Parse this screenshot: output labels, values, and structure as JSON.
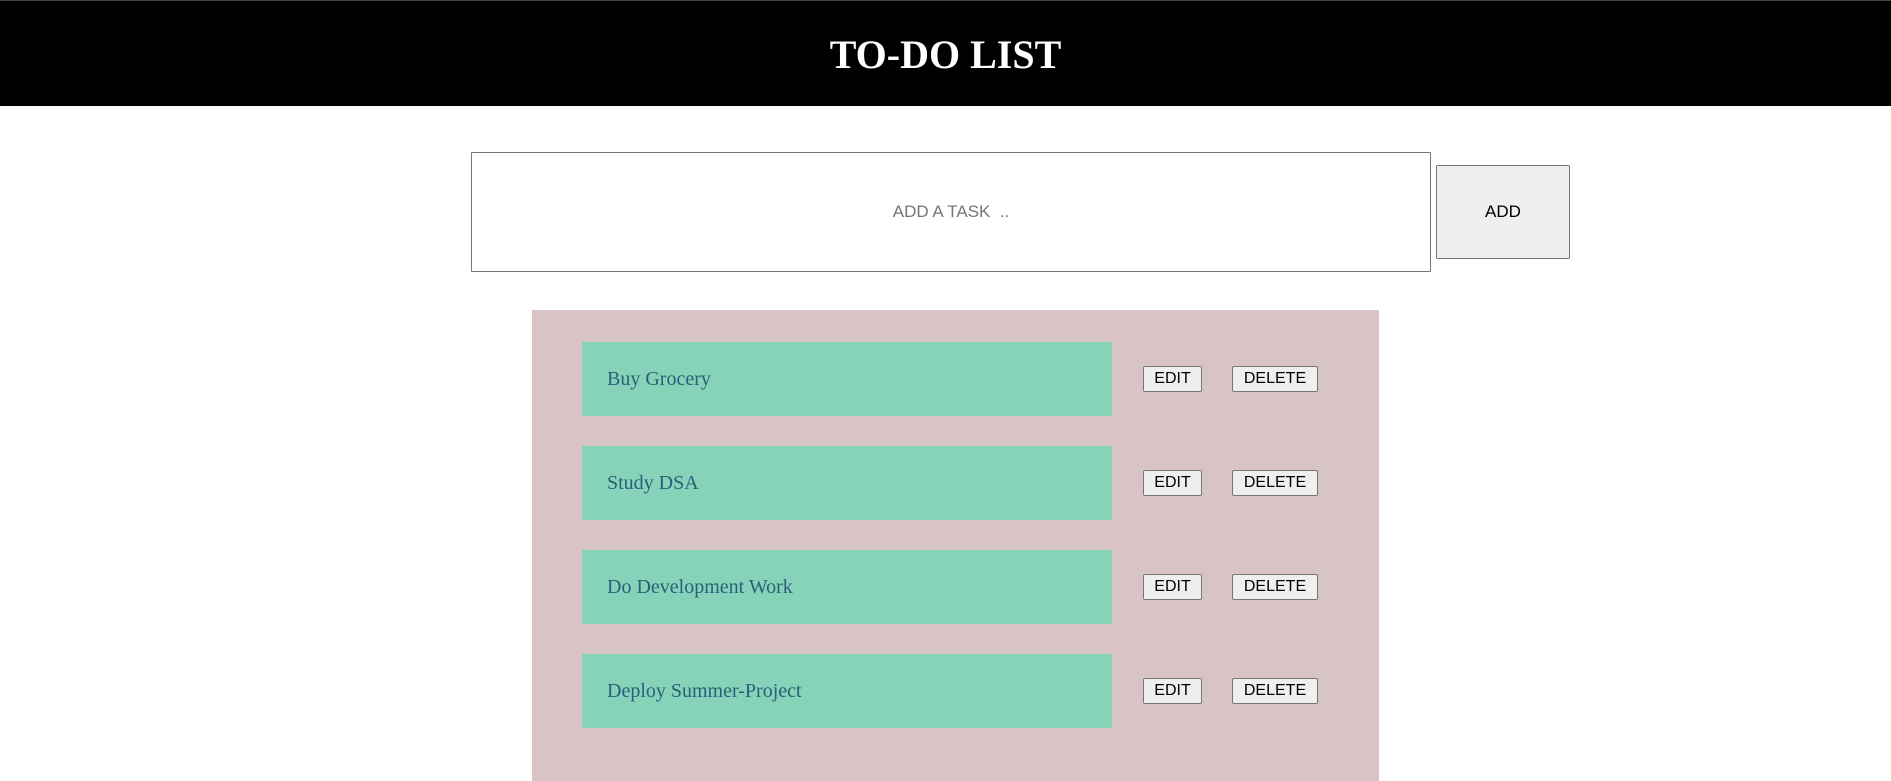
{
  "header": {
    "title": "TO-DO LIST"
  },
  "add_form": {
    "input_value": "",
    "input_placeholder": "ADD A TASK  ..",
    "add_label": "ADD"
  },
  "tasks": [
    {
      "label": "Buy Grocery",
      "edit_label": "EDIT",
      "delete_label": "DELETE"
    },
    {
      "label": "Study DSA",
      "edit_label": "EDIT",
      "delete_label": "DELETE"
    },
    {
      "label": "Do Development Work",
      "edit_label": "EDIT",
      "delete_label": "DELETE"
    },
    {
      "label": "Deploy Summer-Project",
      "edit_label": "EDIT",
      "delete_label": "DELETE"
    }
  ],
  "colors": {
    "header_bg": "#000000",
    "header_text": "#ffffff",
    "panel_bg": "#d8c4c4",
    "task_bg": "#87d3b9",
    "task_text": "#2b5f78",
    "button_bg": "#efefef"
  }
}
